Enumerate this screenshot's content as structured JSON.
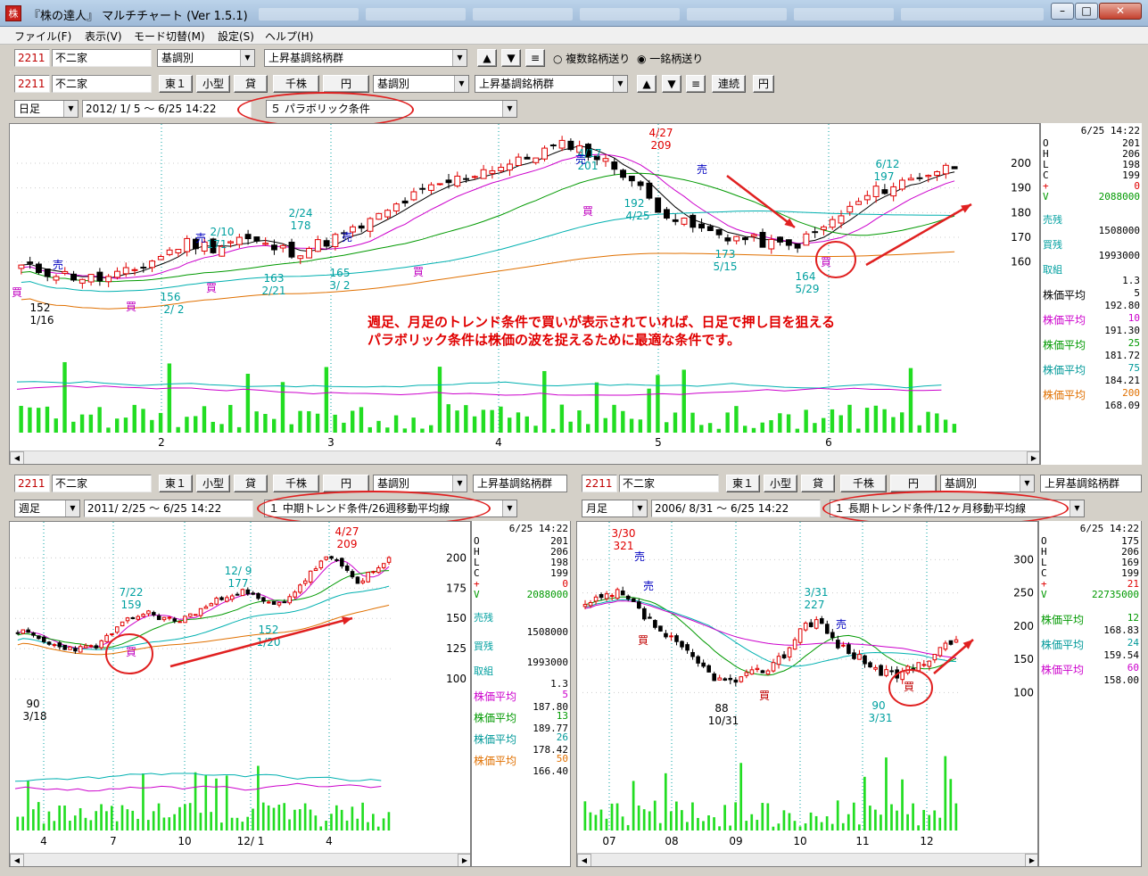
{
  "window": {
    "title": "『株の達人』 マルチチャート (Ver 1.5.1)",
    "icon": "kabu-icon"
  },
  "menu": [
    "ファイル(F)",
    "表示(V)",
    "モード切替(M)",
    "設定(S)",
    "ヘルプ(H)"
  ],
  "row1": {
    "code": "2211",
    "name": "不二家",
    "category": "基調別",
    "group": "上昇基調銘柄群",
    "eq_label": "≡",
    "radio_multi": "複数銘柄送り",
    "radio_single": "一銘柄送り"
  },
  "row2": {
    "code": "2211",
    "name": "不二家",
    "market": "東１",
    "size": "小型",
    "lend": "貸",
    "unit": "千株",
    "currency": "円",
    "category": "基調別",
    "group": "上昇基調銘柄群",
    "eq_label": "≡",
    "continuous": "連続",
    "yen": "円"
  },
  "main": {
    "period": "日足",
    "range": "2012/ 1/ 5 〜 6/25 14:22",
    "condition": "５ パラボリック条件"
  },
  "main_info": {
    "datetime": "6/25 14:22",
    "ohlc": [
      [
        "O",
        "201"
      ],
      [
        "H",
        "206"
      ],
      [
        "L",
        "198"
      ],
      [
        "C",
        "199"
      ],
      [
        "+",
        "0"
      ],
      [
        "V",
        "2088000"
      ]
    ],
    "sell_label": "売残",
    "sell_val": "1508000",
    "buy_label": "買残",
    "buy_val": "1993000",
    "torikumi_label": "取組",
    "torikumi_val": "1.3",
    "ma": [
      {
        "label": "株価平均",
        "n": "5",
        "val": "192.80",
        "color": "#000000"
      },
      {
        "label": "株価平均",
        "n": "10",
        "val": "191.30",
        "color": "#cc00cc"
      },
      {
        "label": "株価平均",
        "n": "25",
        "val": "181.72",
        "color": "#009900"
      },
      {
        "label": "株価平均",
        "n": "75",
        "val": "184.21",
        "color": "#009999"
      },
      {
        "label": "株価平均",
        "n": "200",
        "val": "168.09",
        "color": "#e07000"
      }
    ]
  },
  "annotation": {
    "line1": "週足、月足のトレンド条件で買いが表示されていれば、日足で押し目を狙える",
    "line2": "パラボリック条件は株価の波を捉えるために最適な条件です。"
  },
  "main_chart": {
    "y_ticks": [
      "200",
      "190",
      "180",
      "170",
      "160"
    ],
    "x_ticks": [
      "2",
      "3",
      "4",
      "5",
      "6"
    ],
    "labels": [
      {
        "t": "152",
        "c": "#000"
      },
      {
        "t": "1/16",
        "c": "#000"
      },
      {
        "t": "156",
        "c": "#00a0a0"
      },
      {
        "t": "2/ 2",
        "c": "#00a0a0"
      },
      {
        "t": "2/10",
        "c": "#00a0a0"
      },
      {
        "t": "171",
        "c": "#00a0a0"
      },
      {
        "t": "163",
        "c": "#00a0a0"
      },
      {
        "t": "2/21",
        "c": "#00a0a0"
      },
      {
        "t": "2/24",
        "c": "#00a0a0"
      },
      {
        "t": "178",
        "c": "#00a0a0"
      },
      {
        "t": "165",
        "c": "#00a0a0"
      },
      {
        "t": "3/ 2",
        "c": "#00a0a0"
      },
      {
        "t": "4/17",
        "c": "#00a0a0"
      },
      {
        "t": "201",
        "c": "#00a0a0"
      },
      {
        "t": "4/27",
        "c": "#e00000"
      },
      {
        "t": "209",
        "c": "#e00000"
      },
      {
        "t": "192",
        "c": "#00a0a0"
      },
      {
        "t": "4/25",
        "c": "#00a0a0"
      },
      {
        "t": "173",
        "c": "#00a0a0"
      },
      {
        "t": "5/15",
        "c": "#00a0a0"
      },
      {
        "t": "164",
        "c": "#00a0a0"
      },
      {
        "t": "5/29",
        "c": "#00a0a0"
      },
      {
        "t": "6/12",
        "c": "#00a0a0"
      },
      {
        "t": "197",
        "c": "#00a0a0"
      }
    ],
    "signals": [
      {
        "t": "売",
        "c": "#0000c0"
      },
      {
        "t": "買",
        "c": "#c000c0"
      },
      {
        "t": "買",
        "c": "#c000c0"
      },
      {
        "t": "売",
        "c": "#0000c0"
      },
      {
        "t": "買",
        "c": "#c000c0"
      },
      {
        "t": "売",
        "c": "#0000c0"
      },
      {
        "t": "買",
        "c": "#c000c0"
      },
      {
        "t": "売",
        "c": "#0000c0"
      },
      {
        "t": "買",
        "c": "#c000c0"
      },
      {
        "t": "売",
        "c": "#0000c0"
      },
      {
        "t": "買",
        "c": "#c000c0"
      }
    ]
  },
  "weekly": {
    "code": "2211",
    "name": "不二家",
    "market": "東１",
    "size": "小型",
    "lend": "貸",
    "unit": "千株",
    "currency": "円",
    "category": "基調別",
    "group": "上昇基調銘柄群",
    "period": "週足",
    "range": "2011/ 2/25 〜 6/25 14:22",
    "condition": "１ 中期トレンド条件/26週移動平均線",
    "info": {
      "datetime": "6/25 14:22",
      "ohlc": [
        [
          "O",
          "201"
        ],
        [
          "H",
          "206"
        ],
        [
          "L",
          "198"
        ],
        [
          "C",
          "199"
        ],
        [
          "+",
          "0"
        ],
        [
          "V",
          "2088000"
        ]
      ],
      "sell_label": "売残",
      "sell_val": "1508000",
      "buy_label": "買残",
      "buy_val": "1993000",
      "torikumi_label": "取組",
      "torikumi_val": "1.3",
      "ma": [
        {
          "label": "株価平均",
          "n": "5",
          "val": "187.80",
          "color": "#cc00cc"
        },
        {
          "label": "株価平均",
          "n": "13",
          "val": "189.77",
          "color": "#009900"
        },
        {
          "label": "株価平均",
          "n": "26",
          "val": "178.42",
          "color": "#009999"
        },
        {
          "label": "株価平均",
          "n": "50",
          "val": "166.40",
          "color": "#e07000"
        }
      ]
    },
    "y_ticks": [
      "200",
      "175",
      "150",
      "125",
      "100"
    ],
    "x_ticks": [
      "4",
      "7",
      "10",
      "12/ 1",
      "4"
    ],
    "labels": [
      {
        "t": "7/22",
        "c": "#00a0a0"
      },
      {
        "t": "159",
        "c": "#00a0a0"
      },
      {
        "t": "12/ 9",
        "c": "#00a0a0"
      },
      {
        "t": "177",
        "c": "#00a0a0"
      },
      {
        "t": "152",
        "c": "#00a0a0"
      },
      {
        "t": "1/20",
        "c": "#00a0a0"
      },
      {
        "t": "4/27",
        "c": "#e00000"
      },
      {
        "t": "209",
        "c": "#e00000"
      },
      {
        "t": "90",
        "c": "#000"
      },
      {
        "t": "3/18",
        "c": "#000"
      }
    ],
    "signal": "買"
  },
  "monthly": {
    "code": "2211",
    "name": "不二家",
    "market": "東１",
    "size": "小型",
    "lend": "貸",
    "unit": "千株",
    "currency": "円",
    "category": "基調別",
    "group": "上昇基調銘柄群",
    "period": "月足",
    "range": "2006/ 8/31 〜 6/25 14:22",
    "condition": "１ 長期トレンド条件/12ヶ月移動平均線",
    "info": {
      "datetime": "6/25 14:22",
      "ohlc": [
        [
          "O",
          "175"
        ],
        [
          "H",
          "206"
        ],
        [
          "L",
          "169"
        ],
        [
          "C",
          "199"
        ],
        [
          "+",
          "21"
        ],
        [
          "V",
          "22735000"
        ]
      ],
      "ma": [
        {
          "label": "株価平均",
          "n": "12",
          "val": "168.83",
          "color": "#009900"
        },
        {
          "label": "株価平均",
          "n": "24",
          "val": "159.54",
          "color": "#009999"
        },
        {
          "label": "株価平均",
          "n": "60",
          "val": "158.00",
          "color": "#cc00cc"
        }
      ]
    },
    "y_ticks": [
      "300",
      "250",
      "200",
      "150",
      "100"
    ],
    "x_ticks": [
      "07",
      "08",
      "09",
      "10",
      "11",
      "12"
    ],
    "labels": [
      {
        "t": "3/30",
        "c": "#e00000"
      },
      {
        "t": "321",
        "c": "#e00000"
      },
      {
        "t": "88",
        "c": "#000"
      },
      {
        "t": "10/31",
        "c": "#000"
      },
      {
        "t": "3/31",
        "c": "#00a0a0"
      },
      {
        "t": "227",
        "c": "#00a0a0"
      },
      {
        "t": "90",
        "c": "#00a0a0"
      },
      {
        "t": "3/31",
        "c": "#00a0a0"
      }
    ],
    "signals": [
      {
        "t": "売",
        "c": "#0000c0"
      },
      {
        "t": "売",
        "c": "#0000c0"
      },
      {
        "t": "買",
        "c": "#c00000"
      },
      {
        "t": "買",
        "c": "#c00000"
      },
      {
        "t": "売",
        "c": "#0000c0"
      },
      {
        "t": "買",
        "c": "#c00000"
      }
    ]
  },
  "colors": {
    "up": "#e00000",
    "down": "#000000",
    "volume": "#22dd22",
    "annotation": "#e00000"
  }
}
